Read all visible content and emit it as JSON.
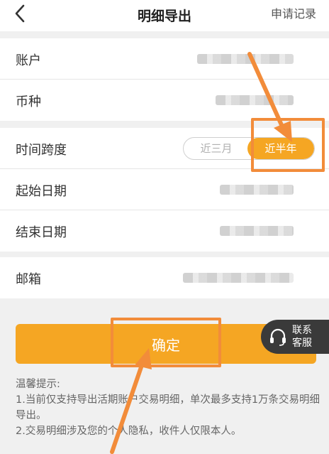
{
  "nav": {
    "back_icon": "chevron-left-icon",
    "title": "明细导出",
    "record_link": "申请记录"
  },
  "form": {
    "account_label": "账户",
    "currency_label": "币种",
    "time_span_label": "时间跨度",
    "time_span_options": [
      "近三月",
      "近半年"
    ],
    "time_span_selected": "近半年",
    "start_date_label": "起始日期",
    "end_date_label": "结束日期",
    "email_label": "邮箱"
  },
  "confirm_button": "确定",
  "customer_service": {
    "icon": "headset-icon",
    "label_line1": "联系",
    "label_line2": "客服"
  },
  "tips": {
    "title": "温馨提示:",
    "line1": "1.当前仅支持导出活期账户交易明细，单次最多支持1万条交易明细导出。",
    "line2": "2.交易明细涉及您的个人隐私，收件人仅限本人。"
  },
  "colors": {
    "accent": "#f5a623",
    "annotation": "#f28c3a"
  }
}
